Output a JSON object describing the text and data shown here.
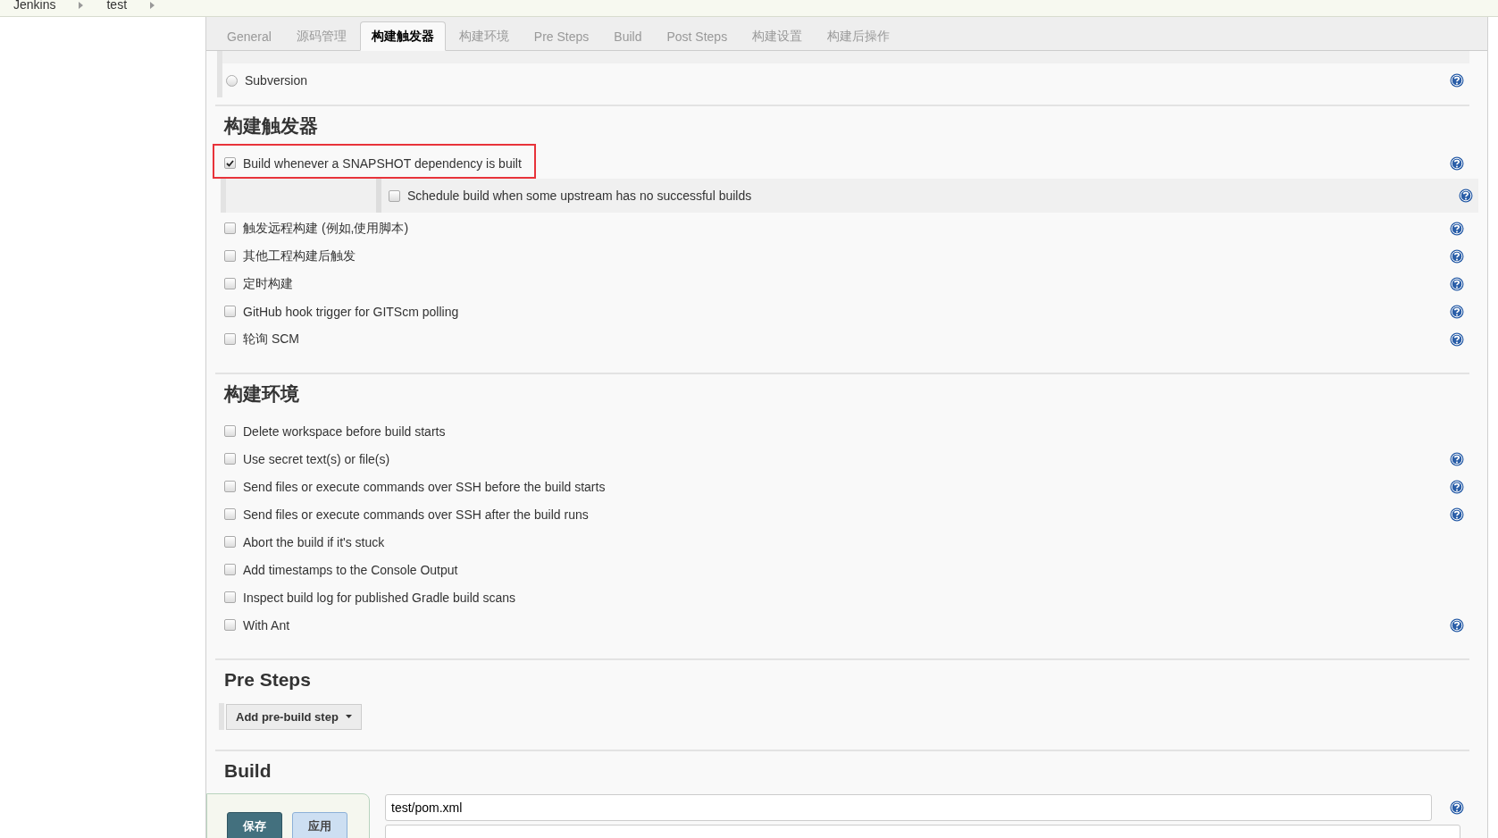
{
  "breadcrumbs": [
    "Jenkins",
    "test"
  ],
  "tabs": [
    {
      "label": "General",
      "selected": false
    },
    {
      "label": "源码管理",
      "selected": false
    },
    {
      "label": "构建触发器",
      "selected": true
    },
    {
      "label": "构建环境",
      "selected": false
    },
    {
      "label": "Pre Steps",
      "selected": false
    },
    {
      "label": "Build",
      "selected": false
    },
    {
      "label": "Post Steps",
      "selected": false
    },
    {
      "label": "构建设置",
      "selected": false
    },
    {
      "label": "构建后操作",
      "selected": false
    }
  ],
  "scm": {
    "options": [
      {
        "label": "Subversion",
        "selected": false,
        "help": true
      }
    ]
  },
  "sections": [
    {
      "title": "构建触发器",
      "options": [
        {
          "label": "Build whenever a SNAPSHOT dependency is built",
          "checked": true,
          "help": true,
          "highlighted": true,
          "children": [
            {
              "label": "Schedule build when some upstream has no successful builds",
              "checked": false,
              "help": true,
              "highlighted": false
            }
          ]
        },
        {
          "label": "触发远程构建 (例如,使用脚本)",
          "checked": false,
          "help": true,
          "highlighted": false
        },
        {
          "label": "其他工程构建后触发",
          "checked": false,
          "help": true,
          "highlighted": false
        },
        {
          "label": "定时构建",
          "checked": false,
          "help": true,
          "highlighted": false
        },
        {
          "label": "GitHub hook trigger for GITScm polling",
          "checked": false,
          "help": true,
          "highlighted": false
        },
        {
          "label": "轮询 SCM",
          "checked": false,
          "help": true,
          "highlighted": false
        }
      ]
    },
    {
      "title": "构建环境",
      "options": [
        {
          "label": "Delete workspace before build starts",
          "checked": false,
          "help": false,
          "highlighted": false
        },
        {
          "label": "Use secret text(s) or file(s)",
          "checked": false,
          "help": true,
          "highlighted": false
        },
        {
          "label": "Send files or execute commands over SSH before the build starts",
          "checked": false,
          "help": true,
          "highlighted": false
        },
        {
          "label": "Send files or execute commands over SSH after the build runs",
          "checked": false,
          "help": true,
          "highlighted": false
        },
        {
          "label": "Abort the build if it's stuck",
          "checked": false,
          "help": false,
          "highlighted": false
        },
        {
          "label": "Add timestamps to the Console Output",
          "checked": false,
          "help": false,
          "highlighted": false
        },
        {
          "label": "Inspect build log for published Gradle build scans",
          "checked": false,
          "help": false,
          "highlighted": false
        },
        {
          "label": "With Ant",
          "checked": false,
          "help": true,
          "highlighted": false
        }
      ]
    }
  ],
  "pre_steps": {
    "title": "Pre Steps",
    "button": "Add pre-build step"
  },
  "build": {
    "title": "Build",
    "root_pom": {
      "value": "test/pom.xml",
      "help": true
    }
  },
  "bottom_bar": {
    "buttons": [
      {
        "label": "保存",
        "kind": "primary"
      },
      {
        "label": "应用",
        "kind": "secondary"
      }
    ]
  }
}
